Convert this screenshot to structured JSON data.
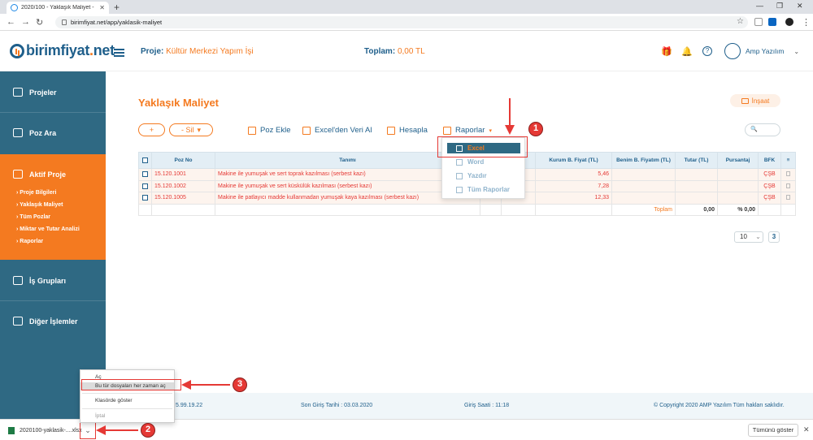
{
  "browser": {
    "tab_title": "2020/100 - Yaklaşık Maliyet - BF...",
    "tab_close": "✕",
    "new_tab": "+",
    "win_min": "—",
    "win_max": "❐",
    "win_close": "✕",
    "back": "←",
    "forward": "→",
    "reload": "↻",
    "url": "birimfiyat.net/app/yaklasik-maliyet",
    "star": "☆",
    "menu": "⋮"
  },
  "header": {
    "logo_main": "birimfiyat",
    "logo_dot": ".",
    "logo_tld": "net",
    "project_label": "Proje:",
    "project_value": "Kültür Merkezi Yapım İşi",
    "total_label": "Toplam:",
    "total_value": "0,00 TL",
    "gift_icon": "🎁",
    "bell_icon": "🔔",
    "help_icon": "?",
    "user_name": "Amp Yazılım",
    "user_chevron": "⌄"
  },
  "sidebar": {
    "items": [
      {
        "label": "Projeler"
      },
      {
        "label": "Poz Ara"
      },
      {
        "label": "Aktif Proje"
      },
      {
        "label": "İş Grupları"
      },
      {
        "label": "Diğer İşlemler"
      }
    ],
    "sub_items": [
      {
        "label": "› Proje Bilgileri"
      },
      {
        "label": "› Yaklaşık Maliyet"
      },
      {
        "label": "› Tüm Pozlar"
      },
      {
        "label": "› Miktar ve Tutar Analizi"
      },
      {
        "label": "› Raporlar"
      }
    ]
  },
  "main": {
    "page_title": "Yaklaşık Maliyet",
    "category_badge": "İnşaat",
    "add_label": "+",
    "delete_label": "- Sil",
    "delete_caret": "▾",
    "toolbar": {
      "poz_ekle": "Poz Ekle",
      "excel_import": "Excel'den Veri Al",
      "hesapla": "Hesapla",
      "raporlar": "Raporlar",
      "raporlar_caret": "▾"
    },
    "search_placeholder": "🔍"
  },
  "table": {
    "headers": {
      "poz_no": "Poz No",
      "tanimi": "Tanımı",
      "kurum_fiyat": "Kurum B. Fiyat (TL)",
      "benim_fiyat": "Benim B. Fiyatım (TL)",
      "tutar": "Tutar (TL)",
      "pursantaj": "Pursantaj",
      "bfk": "BFK",
      "menu": "≡"
    },
    "rows": [
      {
        "poz_no": "15.120.1001",
        "tanim": "Makine ile yumuşak ve sert toprak kazılması (serbest kazı)",
        "kurum_fiyat": "5,46",
        "bfk": "ÇŞB"
      },
      {
        "poz_no": "15.120.1002",
        "tanim": "Makine ile yumuşak ve sert küskülük kazılması (serbest kazı)",
        "kurum_fiyat": "7,28",
        "bfk": "ÇŞB"
      },
      {
        "poz_no": "15.120.1005",
        "tanim": "Makine ile patlayıcı madde kullanmadan yumuşak kaya kazılması (serbest kazı)",
        "kurum_fiyat": "12,33",
        "bfk": "ÇŞB"
      }
    ],
    "total_label": "Toplam",
    "total_value": "0,00",
    "total_pct": "% 0,00"
  },
  "reports_menu": {
    "items": [
      {
        "label": "Excel"
      },
      {
        "label": "Word"
      },
      {
        "label": "Yazdır"
      },
      {
        "label": "Tüm Raporlar"
      }
    ]
  },
  "pager": {
    "page_size": "10",
    "page_size_caret": "⌄",
    "current_page": "3"
  },
  "footer": {
    "version": "5.99.19.22",
    "last_login_date": "Son Giriş Tarihi : 03.03.2020",
    "login_time": "Giriş Saati : 11:18",
    "copyright": "© Copyright 2020 AMP Yazılım Tüm hakları saklıdır."
  },
  "download_bar": {
    "file_name": "2020100-yaklasik-....xlsx",
    "chevron": "⌄",
    "show_all": "Tümünü göster",
    "close": "✕"
  },
  "context_menu": {
    "items": [
      {
        "label": "Aç"
      },
      {
        "label": "Bu tür dosyaları her zaman aç"
      },
      {
        "label": "Klasörde göster"
      },
      {
        "label": "İptal"
      }
    ]
  },
  "annotations": {
    "badges": [
      "1",
      "2",
      "3"
    ]
  },
  "colors": {
    "brand_blue": "#1f5f8b",
    "sidebar": "#2f6983",
    "accent_orange": "#f47a20",
    "annotation_red": "#e53935"
  }
}
